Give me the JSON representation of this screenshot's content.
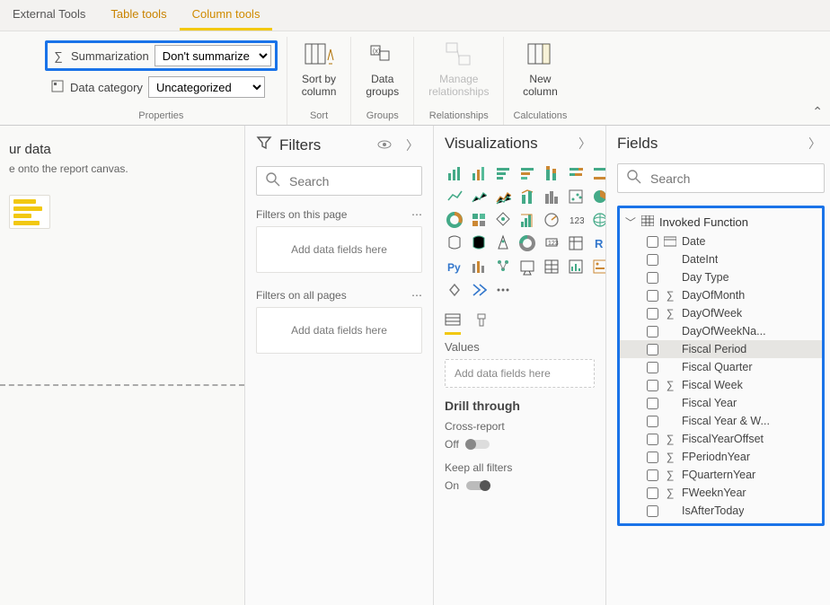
{
  "tabs": {
    "external_tools": "External Tools",
    "table_tools": "Table tools",
    "column_tools": "Column tools"
  },
  "ribbon": {
    "summarization_label": "Summarization",
    "summarization_value": "Don't summarize",
    "data_category_label": "Data category",
    "data_category_value": "Uncategorized",
    "sort_by": "Sort by\ncolumn",
    "data_groups": "Data\ngroups",
    "manage_rel": "Manage\nrelationships",
    "new_column": "New\ncolumn",
    "group_properties": "Properties",
    "group_sort": "Sort",
    "group_groups": "Groups",
    "group_relationships": "Relationships",
    "group_calculations": "Calculations"
  },
  "canvas": {
    "title": "ur data",
    "subtitle": "e onto the report canvas."
  },
  "filters": {
    "title": "Filters",
    "search_placeholder": "Search",
    "on_this_page": "Filters on this page",
    "on_all_pages": "Filters on all pages",
    "drop_hint": "Add data fields here"
  },
  "viz": {
    "title": "Visualizations",
    "values_label": "Values",
    "values_drop": "Add data fields here",
    "drill_title": "Drill through",
    "cross_report": "Cross-report",
    "off": "Off",
    "keep_all": "Keep all filters",
    "on": "On"
  },
  "fields": {
    "title": "Fields",
    "search_placeholder": "Search",
    "table_name": "Invoked Function",
    "items": [
      {
        "name": "Date",
        "icon": "date"
      },
      {
        "name": "DateInt",
        "icon": "none"
      },
      {
        "name": "Day Type",
        "icon": "none"
      },
      {
        "name": "DayOfMonth",
        "icon": "sigma"
      },
      {
        "name": "DayOfWeek",
        "icon": "sigma"
      },
      {
        "name": "DayOfWeekNa...",
        "icon": "none"
      },
      {
        "name": "Fiscal Period",
        "icon": "none",
        "selected": true
      },
      {
        "name": "Fiscal Quarter",
        "icon": "none"
      },
      {
        "name": "Fiscal Week",
        "icon": "sigma"
      },
      {
        "name": "Fiscal Year",
        "icon": "none"
      },
      {
        "name": "Fiscal Year & W...",
        "icon": "none"
      },
      {
        "name": "FiscalYearOffset",
        "icon": "sigma"
      },
      {
        "name": "FPeriodnYear",
        "icon": "sigma"
      },
      {
        "name": "FQuarternYear",
        "icon": "sigma"
      },
      {
        "name": "FWeeknYear",
        "icon": "sigma"
      },
      {
        "name": "IsAfterToday",
        "icon": "none"
      }
    ]
  }
}
